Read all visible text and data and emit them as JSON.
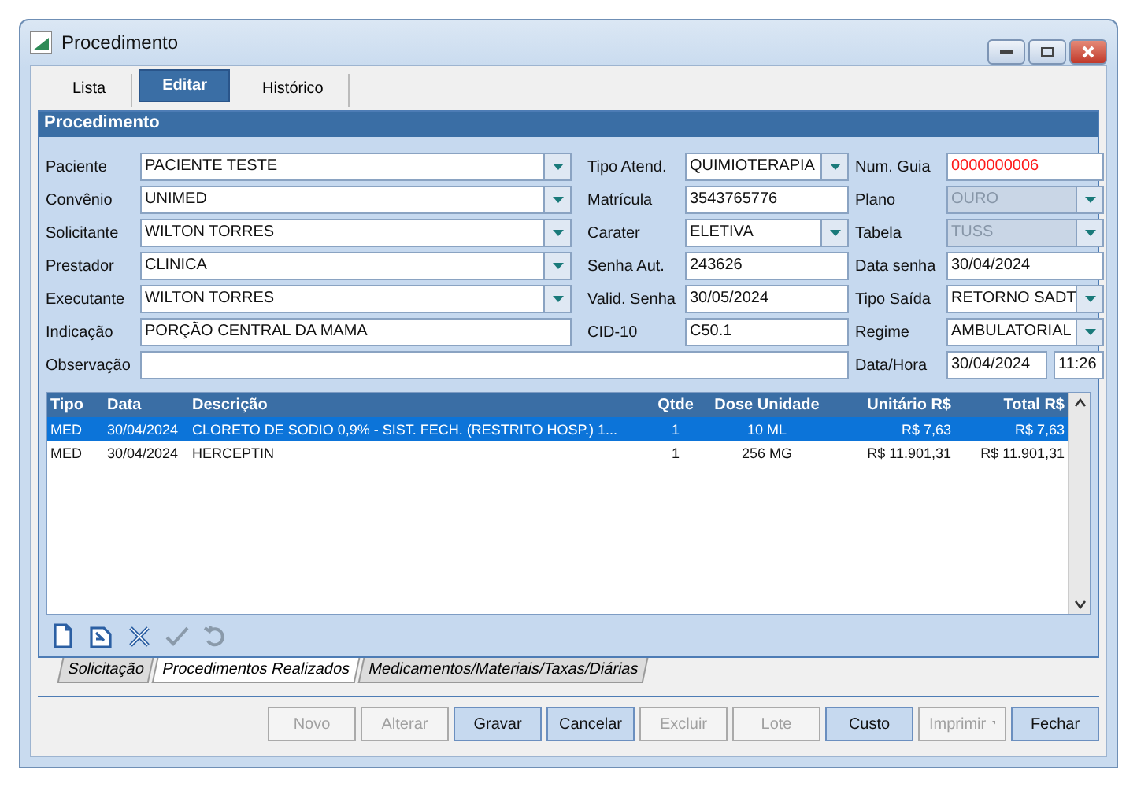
{
  "window": {
    "title": "Procedimento"
  },
  "tabs": [
    {
      "label": "Lista",
      "selected": false
    },
    {
      "label": "Editar",
      "selected": true
    },
    {
      "label": "Histórico",
      "selected": false
    }
  ],
  "panel": {
    "title": "Procedimento"
  },
  "form_left": [
    {
      "label": "Paciente",
      "value": "PACIENTE TESTE",
      "kind": "combo"
    },
    {
      "label": "Convênio",
      "value": "UNIMED",
      "kind": "combo"
    },
    {
      "label": "Solicitante",
      "value": "WILTON TORRES",
      "kind": "combo"
    },
    {
      "label": "Prestador",
      "value": "CLINICA",
      "kind": "combo"
    },
    {
      "label": "Executante",
      "value": "WILTON TORRES",
      "kind": "combo"
    },
    {
      "label": "Indicação",
      "value": "PORÇÃO CENTRAL DA MAMA",
      "kind": "text"
    }
  ],
  "form_middle": [
    {
      "label": "Tipo Atend.",
      "value": "QUIMIOTERAPIA",
      "kind": "combo"
    },
    {
      "label": "Matrícula",
      "value": "3543765776",
      "kind": "text"
    },
    {
      "label": "Carater",
      "value": "ELETIVA",
      "kind": "combo"
    },
    {
      "label": "Senha Aut.",
      "value": "243626",
      "kind": "text"
    },
    {
      "label": "Valid. Senha",
      "value": "30/05/2024",
      "kind": "text"
    },
    {
      "label": "CID-10",
      "value": "C50.1",
      "kind": "text"
    }
  ],
  "form_right": [
    {
      "label": "Num. Guia",
      "value": "0000000006",
      "kind": "text",
      "disabled": false,
      "invalid": true
    },
    {
      "label": "Plano",
      "value": "OURO",
      "kind": "combo",
      "disabled": true,
      "invalid": false
    },
    {
      "label": "Tabela",
      "value": "TUSS",
      "kind": "combo",
      "disabled": true,
      "invalid": false
    },
    {
      "label": "Data senha",
      "value": "30/04/2024",
      "kind": "text",
      "disabled": false,
      "invalid": false
    },
    {
      "label": "Tipo Saída",
      "value": "RETORNO SADT",
      "kind": "combo",
      "disabled": false,
      "invalid": false
    },
    {
      "label": "Regime",
      "value": "AMBULATORIAL",
      "kind": "combo",
      "disabled": false,
      "invalid": false
    }
  ],
  "observacao": {
    "label": "Observação"
  },
  "data_hora": {
    "label": "Data/Hora",
    "date": "30/04/2024",
    "time": "11:26"
  },
  "table": {
    "columns": [
      "Tipo",
      "Data",
      "Descrição",
      "Qtde",
      "Dose Unidade",
      "Unitário R$",
      "Total R$"
    ],
    "rows": [
      {
        "selected": true,
        "cells": [
          "MED",
          "30/04/2024",
          "CLORETO DE SODIO 0,9% - SIST. FECH. (RESTRITO HOSP.) 1...",
          "1",
          "10 ML",
          "R$ 7,63",
          "R$ 7,63"
        ]
      },
      {
        "selected": false,
        "cells": [
          "MED",
          "30/04/2024",
          "HERCEPTIN",
          "1",
          "256 MG",
          "R$ 11.901,31",
          "R$ 11.901,31"
        ]
      }
    ]
  },
  "toolbar": [
    {
      "kind": "new"
    },
    {
      "kind": "edit"
    },
    {
      "kind": "delete"
    },
    {
      "kind": "confirm"
    },
    {
      "kind": "undo"
    }
  ],
  "bottom_tabs": [
    {
      "label": "Solicitação",
      "selected": false
    },
    {
      "label": "Procedimentos Realizados",
      "selected": true
    },
    {
      "label": "Medicamentos/Materiais/Taxas/Diárias",
      "selected": false
    }
  ],
  "buttons": [
    {
      "label": "Novo",
      "disabled": true,
      "kind": "plain"
    },
    {
      "label": "Alterar",
      "disabled": true,
      "kind": "plain"
    },
    {
      "label": "Gravar",
      "disabled": false,
      "kind": "plain"
    },
    {
      "label": "Cancelar",
      "disabled": false,
      "kind": "plain"
    },
    {
      "label": "Excluir",
      "disabled": true,
      "kind": "plain"
    },
    {
      "label": "Lote",
      "disabled": true,
      "kind": "plain"
    },
    {
      "label": "Custo",
      "disabled": false,
      "kind": "plain"
    },
    {
      "label": "Imprimir",
      "disabled": true,
      "kind": "dropdown"
    },
    {
      "label": "Fechar",
      "disabled": false,
      "kind": "plain"
    }
  ]
}
